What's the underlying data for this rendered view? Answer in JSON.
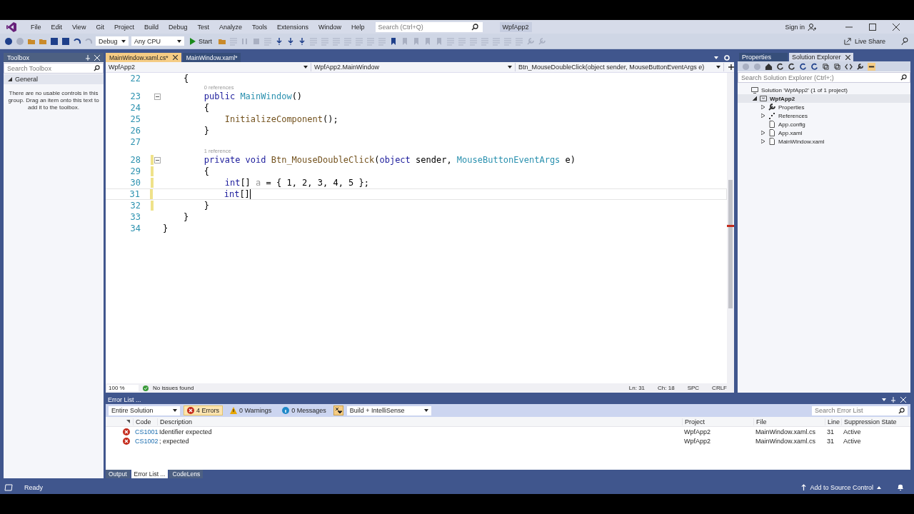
{
  "menu": [
    "File",
    "Edit",
    "View",
    "Git",
    "Project",
    "Build",
    "Debug",
    "Test",
    "Analyze",
    "Tools",
    "Extensions",
    "Window",
    "Help"
  ],
  "search": {
    "placeholder": "Search (Ctrl+Q)"
  },
  "solution_name": "WpfApp2",
  "sign_in": "Sign in",
  "toolbar": {
    "configuration": "Debug",
    "platform": "Any CPU",
    "start": "Start",
    "live_share": "Live Share"
  },
  "toolbox": {
    "title": "Toolbox",
    "search_placeholder": "Search Toolbox",
    "group": "General",
    "expanded": true,
    "message": "There are no usable controls in this group. Drag an item onto this text to add it to the toolbox."
  },
  "editor": {
    "tabs": [
      {
        "label": "MainWindow.xaml.cs*",
        "selected": true
      },
      {
        "label": "MainWindow.xaml*",
        "selected": false
      }
    ],
    "nav": [
      "WpfApp2",
      "WpfApp2.MainWindow",
      "Btn_MouseDoubleClick(object sender, MouseButtonEventArgs e)"
    ],
    "lines": [
      {
        "kind": "code",
        "number": "22",
        "fold": false,
        "changed": false,
        "current": false,
        "caret": false,
        "tokens": [
          {
            "text": "    {",
            "kind": "plain"
          }
        ]
      },
      {
        "kind": "lens",
        "text": "0 references"
      },
      {
        "kind": "code",
        "number": "23",
        "fold": true,
        "changed": false,
        "current": false,
        "caret": false,
        "tokens": [
          {
            "text": "        public",
            "kind": "keyword"
          },
          {
            "text": " MainWindow",
            "kind": "type"
          },
          {
            "text": "()",
            "kind": "plain"
          }
        ]
      },
      {
        "kind": "code",
        "number": "24",
        "fold": false,
        "changed": false,
        "current": false,
        "caret": false,
        "tokens": [
          {
            "text": "        {",
            "kind": "plain"
          }
        ]
      },
      {
        "kind": "code",
        "number": "25",
        "fold": false,
        "changed": false,
        "current": false,
        "caret": false,
        "tokens": [
          {
            "text": "            InitializeComponent",
            "kind": "method"
          },
          {
            "text": "();",
            "kind": "plain"
          }
        ]
      },
      {
        "kind": "code",
        "number": "26",
        "fold": false,
        "changed": false,
        "current": false,
        "caret": false,
        "tokens": [
          {
            "text": "        }",
            "kind": "plain"
          }
        ]
      },
      {
        "kind": "code",
        "number": "27",
        "fold": false,
        "changed": false,
        "current": false,
        "caret": false
      },
      {
        "kind": "lens",
        "text": "1 reference"
      },
      {
        "kind": "code",
        "number": "28",
        "fold": true,
        "changed": true,
        "current": false,
        "caret": false,
        "tokens": [
          {
            "text": "        private void",
            "kind": "keyword"
          },
          {
            "text": " Btn_MouseDoubleClick",
            "kind": "method"
          },
          {
            "text": "(",
            "kind": "plain"
          },
          {
            "text": "object",
            "kind": "keyword"
          },
          {
            "text": " sender, ",
            "kind": "plain"
          },
          {
            "text": "MouseButtonEventArgs",
            "kind": "type"
          },
          {
            "text": " e)",
            "kind": "plain"
          }
        ]
      },
      {
        "kind": "code",
        "number": "29",
        "fold": false,
        "changed": true,
        "current": false,
        "caret": false,
        "tokens": [
          {
            "text": "        {",
            "kind": "plain"
          }
        ]
      },
      {
        "kind": "code",
        "number": "30",
        "fold": false,
        "changed": true,
        "current": false,
        "caret": false,
        "tokens": [
          {
            "text": "            int",
            "kind": "keyword"
          },
          {
            "text": "[] ",
            "kind": "plain"
          },
          {
            "text": "a",
            "kind": "unused"
          },
          {
            "text": " = { 1, 2, 3, 4, 5 };",
            "kind": "plain"
          }
        ]
      },
      {
        "kind": "code",
        "number": "31",
        "fold": false,
        "changed": true,
        "current": true,
        "caret": true,
        "tokens": [
          {
            "text": "            int",
            "kind": "keyword"
          },
          {
            "text": "[]",
            "kind": "plain"
          }
        ]
      },
      {
        "kind": "code",
        "number": "32",
        "fold": false,
        "changed": true,
        "current": false,
        "caret": false,
        "tokens": [
          {
            "text": "        }",
            "kind": "plain"
          }
        ]
      },
      {
        "kind": "code",
        "number": "33",
        "fold": false,
        "changed": false,
        "current": false,
        "caret": false,
        "tokens": [
          {
            "text": "    }",
            "kind": "plain"
          }
        ]
      },
      {
        "kind": "code",
        "number": "34",
        "fold": false,
        "changed": false,
        "current": false,
        "caret": false,
        "tokens": [
          {
            "text": "}",
            "kind": "plain"
          }
        ]
      }
    ],
    "zoom": "100 %",
    "issues": "No issues found",
    "position": [
      "Ln: 31",
      "Ch: 18",
      "SPC",
      "CRLF"
    ]
  },
  "solution_explorer": {
    "tabs": [
      {
        "label": "Properties",
        "selected": false
      },
      {
        "label": "Solution Explorer",
        "selected": true
      }
    ],
    "search_placeholder": "Search Solution Explorer (Ctrl+;)",
    "tree": [
      {
        "label": "Solution 'WpfApp2' (1 of 1 project)",
        "kind": "solution",
        "selected": false,
        "children": [
          {
            "label": "WpfApp2",
            "kind": "project",
            "expanded": true,
            "selected": true,
            "children": [
              {
                "label": "Properties",
                "kind": "properties",
                "expanded": false,
                "selected": false
              },
              {
                "label": "References",
                "kind": "references",
                "expanded": false,
                "selected": false
              },
              {
                "label": "App.config",
                "kind": "config",
                "selected": false
              },
              {
                "label": "App.xaml",
                "kind": "xaml",
                "expanded": false,
                "selected": false
              },
              {
                "label": "MainWindow.xaml",
                "kind": "xaml",
                "expanded": false,
                "selected": false
              }
            ]
          }
        ]
      }
    ]
  },
  "error_list": {
    "title": "Error List ...",
    "scope": "Entire Solution",
    "filters": [
      {
        "label": "4 Errors",
        "kind": "error",
        "selected": true
      },
      {
        "label": "0 Warnings",
        "kind": "warning",
        "selected": false
      },
      {
        "label": "0 Messages",
        "kind": "info",
        "selected": false
      }
    ],
    "source": "Build + IntelliSense",
    "search_placeholder": "Search Error List",
    "columns": [
      "Code",
      "Description",
      "Project",
      "File",
      "Line",
      "Suppression State"
    ],
    "rows": [
      {
        "kind": "error",
        "code": "CS1001",
        "description": "Identifier expected",
        "project": "WpfApp2",
        "file": "MainWindow.xaml.cs",
        "line": "31",
        "state": "Active"
      },
      {
        "kind": "error",
        "code": "CS1002",
        "description": "; expected",
        "project": "WpfApp2",
        "file": "MainWindow.xaml.cs",
        "line": "31",
        "state": "Active"
      }
    ]
  },
  "bottom_tabs": [
    {
      "label": "Output",
      "selected": false
    },
    {
      "label": "Error List ...",
      "selected": true
    },
    {
      "label": "CodeLens",
      "selected": false
    }
  ],
  "status": {
    "text": "Ready",
    "source_control": "Add to Source Control"
  }
}
